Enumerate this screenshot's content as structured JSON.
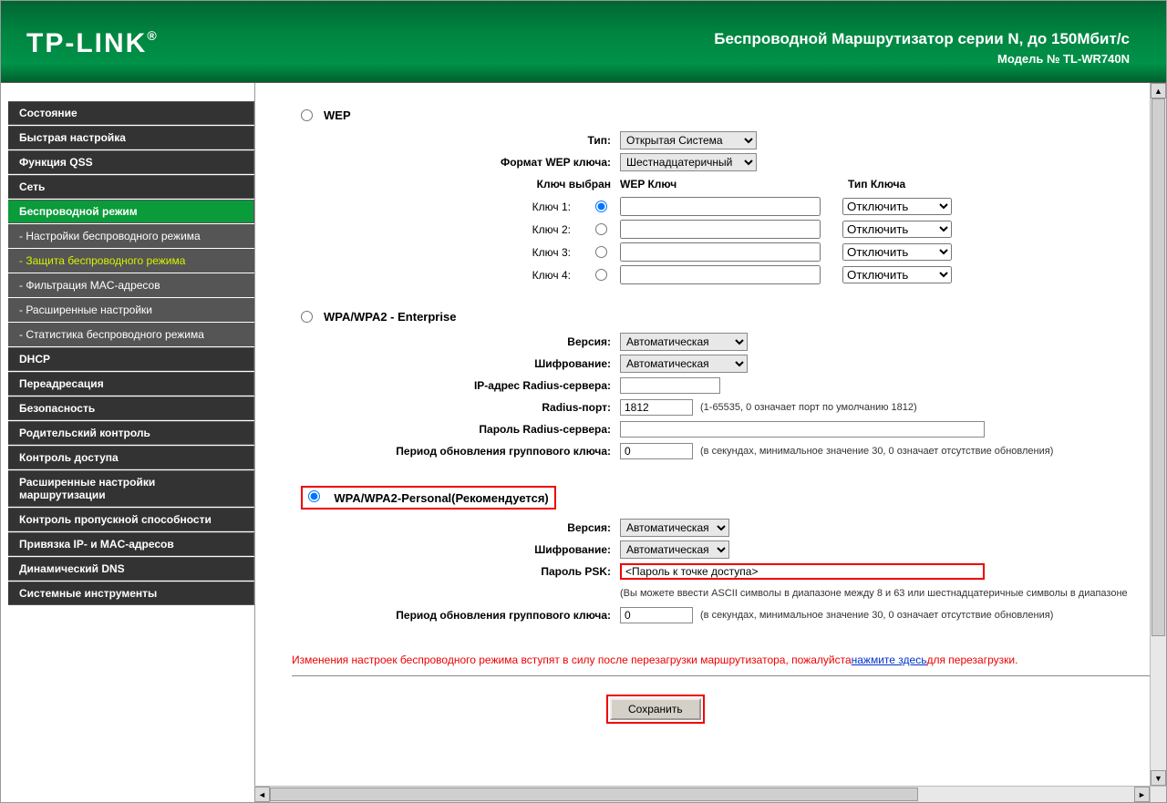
{
  "header": {
    "brand": "TP-LINK",
    "title": "Беспроводной Маршрутизатор серии N, до 150Мбит/с",
    "model": "Модель № TL-WR740N"
  },
  "sidebar": {
    "items": [
      {
        "label": "Состояние",
        "type": "main"
      },
      {
        "label": "Быстрая настройка",
        "type": "main"
      },
      {
        "label": "Функция QSS",
        "type": "main"
      },
      {
        "label": "Сеть",
        "type": "main"
      },
      {
        "label": "Беспроводной режим",
        "type": "main",
        "active": true
      },
      {
        "label": "- Настройки беспроводного режима",
        "type": "sub"
      },
      {
        "label": "- Защита беспроводного режима",
        "type": "sub",
        "active_sub": true
      },
      {
        "label": "- Фильтрация MAC-адресов",
        "type": "sub"
      },
      {
        "label": "- Расширенные настройки",
        "type": "sub"
      },
      {
        "label": "- Статистика беспроводного режима",
        "type": "sub"
      },
      {
        "label": "DHCP",
        "type": "main"
      },
      {
        "label": "Переадресация",
        "type": "main"
      },
      {
        "label": "Безопасность",
        "type": "main"
      },
      {
        "label": "Родительский контроль",
        "type": "main"
      },
      {
        "label": "Контроль доступа",
        "type": "main"
      },
      {
        "label": "Расширенные настройки маршрутизации",
        "type": "main"
      },
      {
        "label": "Контроль пропускной способности",
        "type": "main"
      },
      {
        "label": "Привязка IP- и MAC-адресов",
        "type": "main"
      },
      {
        "label": "Динамический DNS",
        "type": "main"
      },
      {
        "label": "Системные инструменты",
        "type": "main"
      }
    ]
  },
  "wep": {
    "section_label": "WEP",
    "type_label": "Тип:",
    "type_value": "Открытая Система",
    "format_label": "Формат WEP ключа:",
    "format_value": "Шестнадцатеричный",
    "selected_label": "Ключ выбран",
    "key_header": "WEP Ключ",
    "type_header": "Тип Ключа",
    "keys": [
      {
        "label": "Ключ 1:",
        "type": "Отключить",
        "checked": true
      },
      {
        "label": "Ключ 2:",
        "type": "Отключить",
        "checked": false
      },
      {
        "label": "Ключ 3:",
        "type": "Отключить",
        "checked": false
      },
      {
        "label": "Ключ 4:",
        "type": "Отключить",
        "checked": false
      }
    ]
  },
  "enterprise": {
    "section_label": "WPA/WPA2 - Enterprise",
    "version_label": "Версия:",
    "version_value": "Автоматическая",
    "encryption_label": "Шифрование:",
    "encryption_value": "Автоматическая",
    "radius_ip_label": "IP-адрес Radius-сервера:",
    "radius_ip_value": "",
    "radius_port_label": "Radius-порт:",
    "radius_port_value": "1812",
    "radius_port_hint": "(1-65535, 0 означает порт по умолчанию 1812)",
    "radius_pass_label": "Пароль Radius-сервера:",
    "radius_pass_value": "",
    "group_key_label": "Период обновления группового ключа:",
    "group_key_value": "0",
    "group_key_hint": "(в секундах, минимальное значение 30, 0 означает отсутствие обновления)"
  },
  "personal": {
    "section_label": "WPA/WPA2-Personal(Рекомендуется)",
    "version_label": "Версия:",
    "version_value": "Автоматическая",
    "encryption_label": "Шифрование:",
    "encryption_value": "Автоматическая",
    "psk_label": "Пароль PSK:",
    "psk_value": "<Пароль к точке доступа>",
    "psk_hint": "(Вы можете ввести ASCII символы в диапазоне между 8 и 63 или шестнадцатеричные символы в диапазоне",
    "group_key_label": "Период обновления группового ключа:",
    "group_key_value": "0",
    "group_key_hint": "(в секундах, минимальное значение 30, 0 означает отсутствие обновления)"
  },
  "notice": {
    "text_before": "Изменения настроек беспроводного режима вступят в силу после перезагрузки маршрутизатора, пожалуйста",
    "link": "нажмите здесь",
    "text_after": "для перезагрузки."
  },
  "buttons": {
    "save": "Сохранить"
  }
}
